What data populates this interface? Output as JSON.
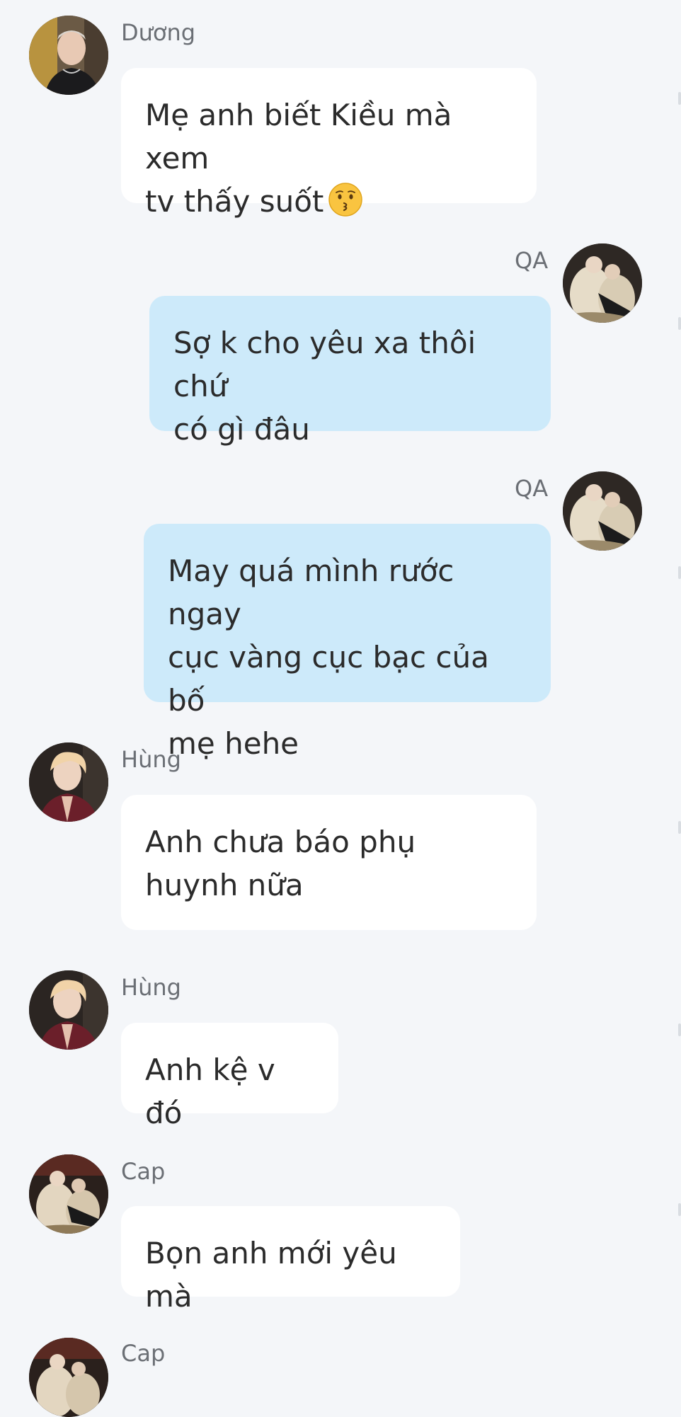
{
  "messages": [
    {
      "direction": "incoming",
      "sender": "Dương",
      "avatar": "avatar-duong",
      "text_lines": [
        "Mẹ anh biết Kiều mà xem",
        "tv thấy suốt"
      ],
      "emoji": "kissing-face-icon"
    },
    {
      "direction": "outgoing",
      "sender": "QA",
      "avatar": "avatar-qa",
      "text_lines": [
        "Sợ k cho yêu xa thôi chứ",
        "có gì đâu"
      ]
    },
    {
      "direction": "outgoing",
      "sender": "QA",
      "avatar": "avatar-qa",
      "text_lines": [
        "May quá mình rước ngay",
        "cục vàng cục bạc của bố",
        "mẹ hehe"
      ]
    },
    {
      "direction": "incoming",
      "sender": "Hùng",
      "avatar": "avatar-hung",
      "text_lines": [
        "Anh chưa báo phụ",
        "huynh nữa"
      ]
    },
    {
      "direction": "incoming",
      "sender": "Hùng",
      "avatar": "avatar-hung",
      "text_lines": [
        "Anh kệ v đó"
      ]
    },
    {
      "direction": "incoming",
      "sender": "Cap",
      "avatar": "avatar-cap",
      "text_lines": [
        "Bọn anh mới yêu mà"
      ]
    },
    {
      "direction": "incoming",
      "sender": "Cap",
      "avatar": "avatar-cap",
      "text_lines": []
    }
  ],
  "colors": {
    "background": "#f4f6f9",
    "incoming_bubble": "#ffffff",
    "outgoing_bubble": "#cdeafa",
    "sender_name": "#6b6f75",
    "message_text": "#2b2b2b"
  }
}
